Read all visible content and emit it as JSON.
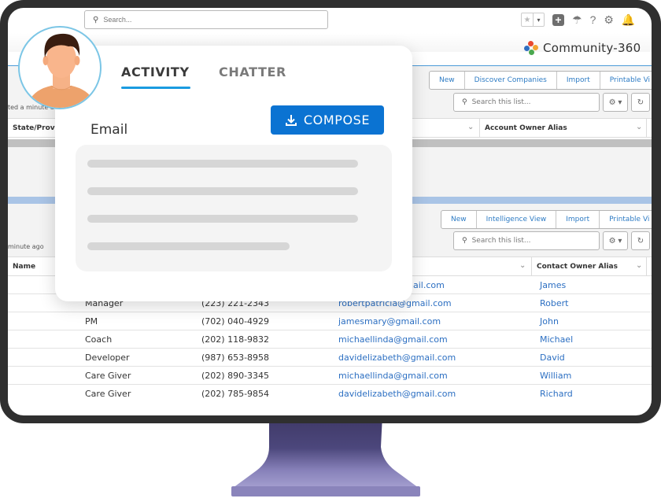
{
  "header": {
    "search_placeholder": "Search...",
    "brand": "Community-360",
    "icons": [
      "favorite-star-icon",
      "dropdown-icon",
      "add-icon",
      "setup-assistant-icon",
      "help-icon",
      "settings-gear-icon",
      "notifications-bell-icon"
    ]
  },
  "accounts_panel": {
    "buttons": [
      "New",
      "Discover Companies",
      "Import",
      "Printable Vi"
    ],
    "search_placeholder": "Search this list...",
    "updated_text": "ted a minute a",
    "columns": [
      "State/Provinc",
      "Account Owner Alias"
    ]
  },
  "contacts_panel": {
    "buttons": [
      "New",
      "Intelligence View",
      "Import",
      "Printable Vi"
    ],
    "search_placeholder": "Search this list...",
    "updated_text": "minute ago",
    "columns": [
      "Name",
      "Contact Owner Alias"
    ],
    "rows": [
      {
        "title": "",
        "phone": "",
        "email": "jamesmary@gmail.com",
        "email_visible": "nail.com",
        "owner": "James"
      },
      {
        "title": "Manager",
        "phone": "(223) 221-2343",
        "email": "robertpatricia@gmail.com",
        "owner": "Robert"
      },
      {
        "title": "PM",
        "phone": "(702) 040-4929",
        "email": "jamesmary@gmail.com",
        "owner": "John"
      },
      {
        "title": "Coach",
        "phone": "(202) 118-9832",
        "email": "michaellinda@gmail.com",
        "owner": "Michael"
      },
      {
        "title": "Developer",
        "phone": "(987) 653-8958",
        "email": "davidelizabeth@gmail.com",
        "owner": "David"
      },
      {
        "title": "Care Giver",
        "phone": "(202) 890-3345",
        "email": "michaellinda@gmail.com",
        "owner": "William"
      },
      {
        "title": "Care Giver",
        "phone": "(202) 785-9854",
        "email": "davidelizabeth@gmail.com",
        "owner": "Richard"
      }
    ]
  },
  "activity_card": {
    "tabs": [
      {
        "label": "ACTIVITY",
        "active": true
      },
      {
        "label": "CHATTER",
        "active": false
      }
    ],
    "section_label": "Email",
    "compose_label": "COMPOSE",
    "accent_color": "#0b73d2",
    "tab_underline_color": "#1a9be0"
  }
}
